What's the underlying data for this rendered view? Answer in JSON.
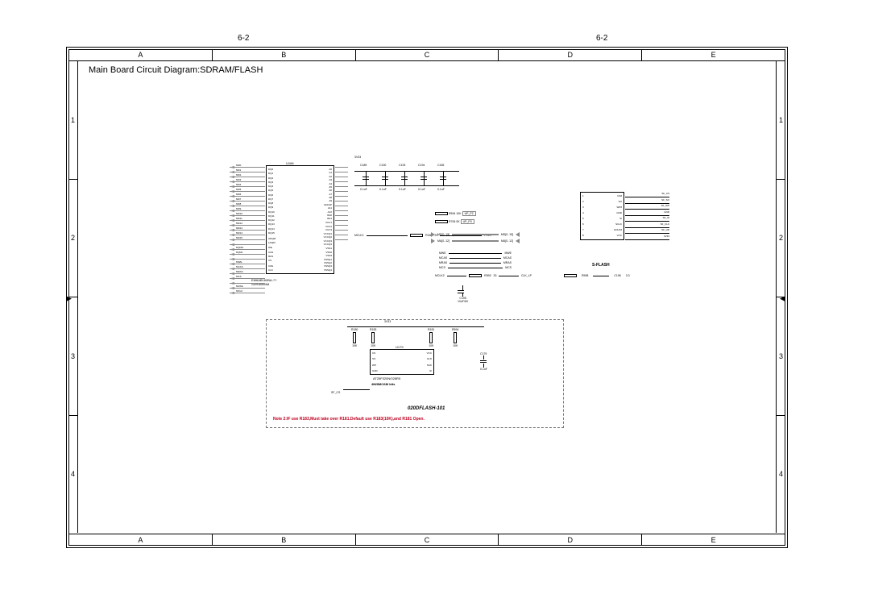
{
  "page": {
    "number_left": "6-2",
    "number_right": "6-2",
    "title": "Main Board Circuit Diagram:SDRAM/FLASH",
    "cols": [
      "A",
      "B",
      "C",
      "D",
      "E"
    ],
    "rows": [
      "1",
      "2",
      "3",
      "4"
    ]
  },
  "sdram": {
    "ref": "U166",
    "part": "EM6AB160BA-??",
    "sub": "SDRAM64M",
    "pins_left": [
      "DQ0",
      "DQ1",
      "DQ2",
      "DQ3",
      "DQ4",
      "DQ5",
      "DQ6",
      "DQ7",
      "DQ8",
      "DQ9",
      "DQ10",
      "DQ11",
      "DQ12",
      "DQ13",
      "DQ14",
      "DQ15",
      "",
      "UDQM",
      "LDQM",
      "",
      "WE",
      "CAS",
      "RAS",
      "CS",
      "",
      "CKE",
      "CLK"
    ],
    "pins_right": [
      "A0",
      "A1",
      "A2",
      "A3",
      "A4",
      "A5",
      "A6",
      "A7",
      "A8",
      "A9",
      "A10/AP",
      "A11",
      "A12",
      "BA0",
      "BA1",
      "",
      "",
      "VCC1",
      "VCC2",
      "VCC3",
      "",
      "VCCQ1",
      "VCCQ2",
      "VCCQ3",
      "VCCQ4",
      "",
      "",
      "VSS1",
      "VSS2",
      "VSS3",
      "",
      "VSSQ1",
      "VSSQ2",
      "VSSQ3",
      "VSSQ4"
    ],
    "bus_left_labels": [
      "MD0",
      "MD1",
      "MD2",
      "MD3",
      "MD4",
      "MD5",
      "MD6",
      "MD7",
      "MD8",
      "MD9",
      "MD10",
      "MD11",
      "MD12",
      "MD13",
      "MD14",
      "MD15",
      "",
      "DQMH",
      "DQML",
      "",
      "MWE",
      "MCAS",
      "MRAS",
      "MCS",
      "",
      "MCKE",
      "MCLK"
    ]
  },
  "decaps": {
    "rail": "3V33",
    "items": [
      {
        "ref": "C189",
        "val": "0.1uF"
      },
      {
        "ref": "C190",
        "val": "0.1uF"
      },
      {
        "ref": "C193",
        "val": "0.1uF"
      },
      {
        "ref": "C194",
        "val": "0.1uF"
      },
      {
        "ref": "C165",
        "val": "0.1uF"
      }
    ]
  },
  "mid_nets": {
    "rr_rows": [
      {
        "ref": "R594",
        "val": "10K",
        "net": "UP_P2"
      },
      {
        "ref": "R706",
        "val": "0K",
        "net": "UP_P0"
      }
    ],
    "series_res1": {
      "ref": "R188",
      "val": "33",
      "from": "MCLK1",
      "to": "PCLK"
    },
    "bus_rows": [
      {
        "left": "MD[0..15]",
        "right": "MD[0..15]"
      },
      {
        "left": "MA[0..12]",
        "right": "MA[0..12]"
      }
    ],
    "ctrl_rows": [
      {
        "l": "MWE",
        "r": "MWE"
      },
      {
        "l": "MCAS",
        "r": "MCAS"
      },
      {
        "l": "MRAS",
        "r": "MRAS"
      },
      {
        "l": "MCS",
        "r": "MCS"
      }
    ],
    "series_res2": {
      "ref": "R593",
      "val": "33",
      "from": "MCLK2",
      "to": "CLK_LP"
    },
    "bulk_cap": {
      "ref": "C195",
      "val": "10uF/6V"
    }
  },
  "sflash": {
    "ref": "U197",
    "pins": [
      {
        "num": "1",
        "name": "CS#",
        "net": "SF_CS"
      },
      {
        "num": "2",
        "name": "SO",
        "net": "SF_SO"
      },
      {
        "num": "3",
        "name": "WP#",
        "net": "SF_WP"
      },
      {
        "num": "4",
        "name": "GND",
        "net": "GND"
      },
      {
        "num": "5",
        "name": "SI",
        "net": "SF_SI"
      },
      {
        "num": "6",
        "name": "SCLK",
        "net": "SF_CLK"
      },
      {
        "num": "7",
        "name": "HOLD#",
        "net": "SF_HD"
      },
      {
        "num": "8",
        "name": "VCC",
        "net": "3V33"
      }
    ],
    "label": "S-FLASH",
    "sub_res": {
      "ref": "R598",
      "val": ""
    },
    "sub_cap": {
      "ref": "C196",
      "val": "10nF"
    },
    "pwr": "3.3"
  },
  "flash": {
    "block_title": "020DFLASH-101",
    "chip_ref": "U179",
    "chip_part": "AT25F020N/028R5",
    "note_bits": "4M/8M/16M bits",
    "pins_left": [
      "CS",
      "SO",
      "WP",
      "GND"
    ],
    "pins_right": [
      "VCC",
      "HLD",
      "SCK",
      "SI"
    ],
    "resistors": [
      {
        "ref": "R180",
        "val": "10K"
      },
      {
        "ref": "R183",
        "val": "10K"
      },
      {
        "ref": "R181",
        "val": "10K"
      },
      {
        "ref": "R594",
        "val": "10K"
      }
    ],
    "cap": {
      "ref": "C179",
      "val": "0.1uF"
    },
    "vcc": "3V33",
    "net_left": "SF_CS",
    "note2": "Note 2:IF use R183,Must take over R181.Default use R183(10K),and R181 Open."
  }
}
